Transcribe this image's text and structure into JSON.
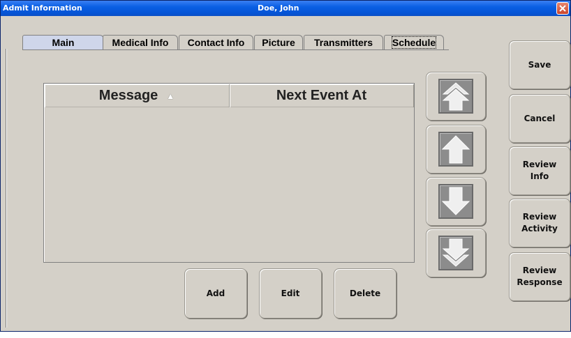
{
  "window": {
    "title": "Admit Information",
    "patient_name": "Doe, John"
  },
  "tabs": [
    {
      "label": "Main",
      "active": true
    },
    {
      "label": "Medical Info"
    },
    {
      "label": "Contact Info"
    },
    {
      "label": "Picture"
    },
    {
      "label": "Transmitters"
    },
    {
      "label": "Schedule",
      "focused": true
    }
  ],
  "table": {
    "columns": [
      {
        "label": "Message",
        "sorted": "ascending"
      },
      {
        "label": "Next Event At"
      }
    ],
    "rows": []
  },
  "arrow_buttons": [
    {
      "icon": "move-to-top-icon"
    },
    {
      "icon": "move-up-icon"
    },
    {
      "icon": "move-down-icon"
    },
    {
      "icon": "move-to-bottom-icon"
    }
  ],
  "bottom_buttons": {
    "add": "Add",
    "edit": "Edit",
    "delete": "Delete"
  },
  "side_buttons": {
    "save": "Save",
    "cancel": "Cancel",
    "review_info": [
      "Review",
      "Info"
    ],
    "review_activity": [
      "Review",
      "Activity"
    ],
    "review_response": [
      "Review",
      "Response"
    ]
  },
  "colors": {
    "titlebar": "#0554d6",
    "active_tab": "#cfd6ea",
    "window_bg": "#d4d0c8",
    "arrow_face": "#8c8c8c"
  }
}
